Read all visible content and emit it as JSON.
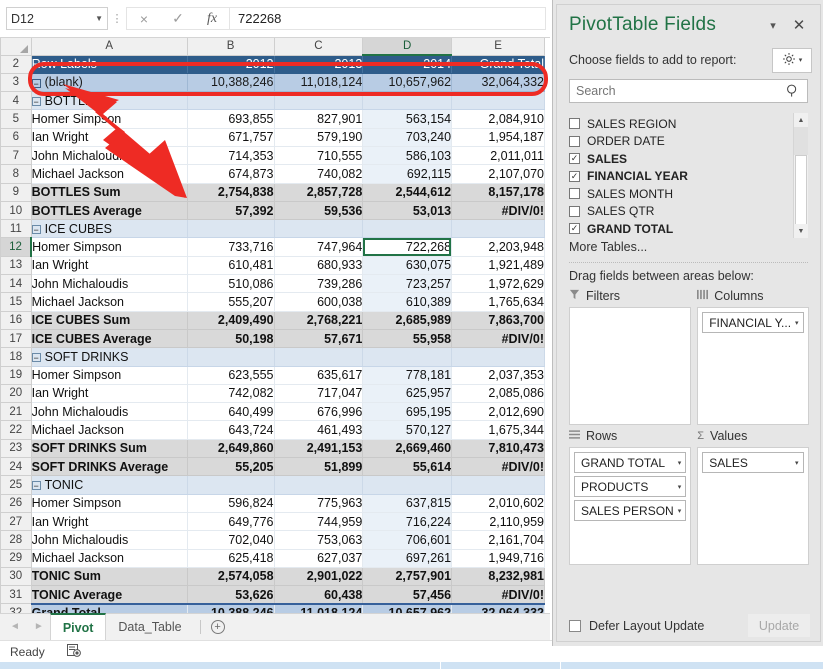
{
  "formula_bar": {
    "name_box_value": "D12",
    "cancel_icon": "×",
    "confirm_icon": "✓",
    "function_icon": "fx",
    "formula_value": "722268"
  },
  "grid": {
    "column_headers": [
      "A",
      "B",
      "C",
      "D",
      "E"
    ],
    "selected_column": "D",
    "selected_row": "12",
    "selected_cell": "D12",
    "rows": [
      {
        "n": "2",
        "type": "hdr",
        "label": "Row Labels",
        "indent": 0,
        "expander": "",
        "b": "2012",
        "c": "2013",
        "d": "2014",
        "e": "Grand Total"
      },
      {
        "n": "3",
        "type": "blank",
        "label": "(blank)",
        "indent": 0,
        "expander": "−",
        "b": "10,388,246",
        "c": "11,018,124",
        "d": "10,657,962",
        "e": "32,064,332"
      },
      {
        "n": "4",
        "type": "cat",
        "label": "BOTTLES",
        "indent": 1,
        "expander": "−",
        "b": "",
        "c": "",
        "d": "",
        "e": ""
      },
      {
        "n": "5",
        "type": "data",
        "label": "Homer Simpson",
        "indent": 2,
        "expander": "",
        "b": "693,855",
        "c": "827,901",
        "d": "563,154",
        "e": "2,084,910"
      },
      {
        "n": "6",
        "type": "data",
        "label": "Ian Wright",
        "indent": 2,
        "expander": "",
        "b": "671,757",
        "c": "579,190",
        "d": "703,240",
        "e": "1,954,187"
      },
      {
        "n": "7",
        "type": "data",
        "label": "John Michaloudis",
        "indent": 2,
        "expander": "",
        "b": "714,353",
        "c": "710,555",
        "d": "586,103",
        "e": "2,011,011"
      },
      {
        "n": "8",
        "type": "data",
        "label": "Michael Jackson",
        "indent": 2,
        "expander": "",
        "b": "674,873",
        "c": "740,082",
        "d": "692,115",
        "e": "2,107,070"
      },
      {
        "n": "9",
        "type": "tot",
        "label": "BOTTLES Sum",
        "indent": 0,
        "expander": "",
        "b": "2,754,838",
        "c": "2,857,728",
        "d": "2,544,612",
        "e": "8,157,178"
      },
      {
        "n": "10",
        "type": "tot",
        "label": "BOTTLES Average",
        "indent": 0,
        "expander": "",
        "b": "57,392",
        "c": "59,536",
        "d": "53,013",
        "e": "#DIV/0!"
      },
      {
        "n": "11",
        "type": "cat",
        "label": "ICE CUBES",
        "indent": 1,
        "expander": "−",
        "b": "",
        "c": "",
        "d": "",
        "e": ""
      },
      {
        "n": "12",
        "type": "data",
        "label": "Homer Simpson",
        "indent": 2,
        "expander": "",
        "b": "733,716",
        "c": "747,964",
        "d": "722,268",
        "e": "2,203,948",
        "selected": true
      },
      {
        "n": "13",
        "type": "data",
        "label": "Ian Wright",
        "indent": 2,
        "expander": "",
        "b": "610,481",
        "c": "680,933",
        "d": "630,075",
        "e": "1,921,489"
      },
      {
        "n": "14",
        "type": "data",
        "label": "John Michaloudis",
        "indent": 2,
        "expander": "",
        "b": "510,086",
        "c": "739,286",
        "d": "723,257",
        "e": "1,972,629"
      },
      {
        "n": "15",
        "type": "data",
        "label": "Michael Jackson",
        "indent": 2,
        "expander": "",
        "b": "555,207",
        "c": "600,038",
        "d": "610,389",
        "e": "1,765,634"
      },
      {
        "n": "16",
        "type": "tot",
        "label": "ICE CUBES Sum",
        "indent": 0,
        "expander": "",
        "b": "2,409,490",
        "c": "2,768,221",
        "d": "2,685,989",
        "e": "7,863,700"
      },
      {
        "n": "17",
        "type": "tot",
        "label": "ICE CUBES Average",
        "indent": 0,
        "expander": "",
        "b": "50,198",
        "c": "57,671",
        "d": "55,958",
        "e": "#DIV/0!"
      },
      {
        "n": "18",
        "type": "cat",
        "label": "SOFT DRINKS",
        "indent": 1,
        "expander": "−",
        "b": "",
        "c": "",
        "d": "",
        "e": ""
      },
      {
        "n": "19",
        "type": "data",
        "label": "Homer Simpson",
        "indent": 2,
        "expander": "",
        "b": "623,555",
        "c": "635,617",
        "d": "778,181",
        "e": "2,037,353"
      },
      {
        "n": "20",
        "type": "data",
        "label": "Ian Wright",
        "indent": 2,
        "expander": "",
        "b": "742,082",
        "c": "717,047",
        "d": "625,957",
        "e": "2,085,086"
      },
      {
        "n": "21",
        "type": "data",
        "label": "John Michaloudis",
        "indent": 2,
        "expander": "",
        "b": "640,499",
        "c": "676,996",
        "d": "695,195",
        "e": "2,012,690"
      },
      {
        "n": "22",
        "type": "data",
        "label": "Michael Jackson",
        "indent": 2,
        "expander": "",
        "b": "643,724",
        "c": "461,493",
        "d": "570,127",
        "e": "1,675,344"
      },
      {
        "n": "23",
        "type": "tot",
        "label": "SOFT DRINKS Sum",
        "indent": 0,
        "expander": "",
        "b": "2,649,860",
        "c": "2,491,153",
        "d": "2,669,460",
        "e": "7,810,473"
      },
      {
        "n": "24",
        "type": "tot",
        "label": "SOFT DRINKS Average",
        "indent": 0,
        "expander": "",
        "b": "55,205",
        "c": "51,899",
        "d": "55,614",
        "e": "#DIV/0!"
      },
      {
        "n": "25",
        "type": "cat",
        "label": "TONIC",
        "indent": 1,
        "expander": "−",
        "b": "",
        "c": "",
        "d": "",
        "e": ""
      },
      {
        "n": "26",
        "type": "data",
        "label": "Homer Simpson",
        "indent": 2,
        "expander": "",
        "b": "596,824",
        "c": "775,963",
        "d": "637,815",
        "e": "2,010,602"
      },
      {
        "n": "27",
        "type": "data",
        "label": "Ian Wright",
        "indent": 2,
        "expander": "",
        "b": "649,776",
        "c": "744,959",
        "d": "716,224",
        "e": "2,110,959"
      },
      {
        "n": "28",
        "type": "data",
        "label": "John Michaloudis",
        "indent": 2,
        "expander": "",
        "b": "702,040",
        "c": "753,063",
        "d": "706,601",
        "e": "2,161,704"
      },
      {
        "n": "29",
        "type": "data",
        "label": "Michael Jackson",
        "indent": 2,
        "expander": "",
        "b": "625,418",
        "c": "627,037",
        "d": "697,261",
        "e": "1,949,716"
      },
      {
        "n": "30",
        "type": "tot",
        "label": "TONIC Sum",
        "indent": 0,
        "expander": "",
        "b": "2,574,058",
        "c": "2,901,022",
        "d": "2,757,901",
        "e": "8,232,981"
      },
      {
        "n": "31",
        "type": "tot",
        "label": "TONIC Average",
        "indent": 0,
        "expander": "",
        "b": "53,626",
        "c": "60,438",
        "d": "57,456",
        "e": "#DIV/0!"
      },
      {
        "n": "32",
        "type": "grand",
        "label": "Grand Total",
        "indent": 0,
        "expander": "",
        "b": "10,388,246",
        "c": "11,018,124",
        "d": "10,657,962",
        "e": "32,064,332"
      }
    ]
  },
  "tabs": {
    "prev_icon": "◄",
    "next_icon": "►",
    "sheets": [
      {
        "name": "Pivot",
        "active": true
      },
      {
        "name": "Data_Table",
        "active": false
      }
    ],
    "add_sheet_icon": "+"
  },
  "status_bar": {
    "state": "Ready",
    "macro_icon": "recording-icon"
  },
  "pane": {
    "title": "PivotTable Fields",
    "menu_icon": "▾",
    "close_icon": "✕",
    "choose_label": "Choose fields to add to report:",
    "gear_icon": "⚙",
    "gear_caret": "▾",
    "search_placeholder": "Search",
    "search_icon": "⌕",
    "fields": [
      {
        "label": "SALES REGION",
        "checked": false
      },
      {
        "label": "ORDER DATE",
        "checked": false
      },
      {
        "label": "SALES",
        "checked": true
      },
      {
        "label": "FINANCIAL YEAR",
        "checked": true
      },
      {
        "label": "SALES MONTH",
        "checked": false
      },
      {
        "label": "SALES QTR",
        "checked": false
      },
      {
        "label": "GRAND TOTAL",
        "checked": true
      }
    ],
    "checkmark": "✓",
    "more_tables": "More Tables...",
    "scroll_up_icon": "▲",
    "scroll_down_icon": "▼",
    "drag_label": "Drag fields between areas below:",
    "areas": {
      "filters": {
        "title": "Filters",
        "icon": "▼",
        "items": []
      },
      "columns": {
        "title": "Columns",
        "icon": "▥",
        "items": [
          {
            "label": "FINANCIAL Y...",
            "caret": "▾"
          }
        ]
      },
      "rows": {
        "title": "Rows",
        "icon": "≡",
        "items": [
          {
            "label": "GRAND TOTAL",
            "caret": "▾"
          },
          {
            "label": "PRODUCTS",
            "caret": "▾"
          },
          {
            "label": "SALES PERSON",
            "caret": "▾"
          }
        ]
      },
      "values": {
        "title": "Values",
        "icon": "Σ",
        "items": [
          {
            "label": "SALES",
            "caret": "▾"
          }
        ]
      }
    },
    "defer_label": "Defer Layout Update",
    "update_label": "Update"
  },
  "colors": {
    "excel_green": "#217346",
    "header_blue": "#2e5c8a",
    "blank_row_blue": "#b8cce4",
    "category_blue": "#dce6f1",
    "total_gray": "#d9d9d9",
    "callout_red": "#ee2b24"
  }
}
